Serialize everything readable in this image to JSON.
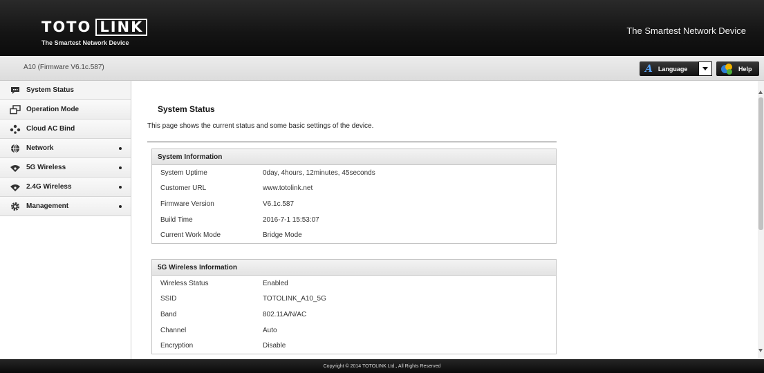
{
  "header": {
    "logo_left": "TOTO",
    "logo_right": "LINK",
    "logo_tagline": "The Smartest Network Device",
    "slogan": "The Smartest Network Device"
  },
  "subbar": {
    "model": "A10 (Firmware V6.1c.587)",
    "language_label": "Language",
    "help_label": "Help"
  },
  "sidebar": {
    "items": [
      {
        "label": "System Status",
        "icon": "chat-bubble-icon"
      },
      {
        "label": "Operation Mode",
        "icon": "windows-icon"
      },
      {
        "label": "Cloud AC Bind",
        "icon": "cloud-nodes-icon"
      },
      {
        "label": "Network",
        "icon": "globe-icon"
      },
      {
        "label": "5G Wireless",
        "icon": "wifi-icon"
      },
      {
        "label": "2.4G Wireless",
        "icon": "wifi-icon"
      },
      {
        "label": "Management",
        "icon": "gear-icon"
      }
    ]
  },
  "main": {
    "title": "System Status",
    "description": "This page shows the current status and some basic settings of the device.",
    "system_info": {
      "heading": "System Information",
      "rows": [
        {
          "key": "System Uptime",
          "value": "0day, 4hours, 12minutes, 45seconds"
        },
        {
          "key": "Customer URL",
          "value": "www.totolink.net"
        },
        {
          "key": "Firmware Version",
          "value": "V6.1c.587"
        },
        {
          "key": "Build Time",
          "value": "2016-7-1 15:53:07"
        },
        {
          "key": "Current Work Mode",
          "value": "Bridge Mode"
        }
      ]
    },
    "wireless_5g": {
      "heading": "5G Wireless Information",
      "rows": [
        {
          "key": "Wireless Status",
          "value": "Enabled"
        },
        {
          "key": "SSID",
          "value": "TOTOLINK_A10_5G"
        },
        {
          "key": "Band",
          "value": "802.11A/N/AC"
        },
        {
          "key": "Channel",
          "value": "Auto"
        },
        {
          "key": "Encryption",
          "value": "Disable"
        }
      ]
    }
  },
  "footer": {
    "copyright": "Copyright © 2014 TOTOLINK Ltd.,   All Rights Reserved"
  },
  "colors": {
    "header_bg": "#141414",
    "accent_blue": "#5aa7ff"
  }
}
